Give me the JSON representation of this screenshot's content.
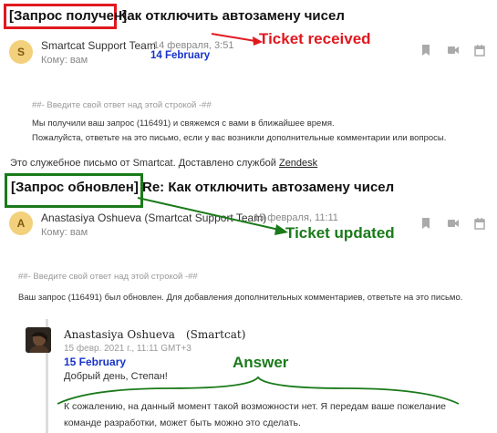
{
  "ticket1": {
    "status_tag": "[Запрос получен]",
    "subject": "Как отключить автозамену чисел",
    "avatar_letter": "S",
    "sender": "Smartcat Support Team",
    "date": "14 февраля, 3:51",
    "to": "Кому: вам",
    "date_note": "14 February",
    "annotation": "Ticket received",
    "reply_marker": "##- Введите свой ответ над этой строкой -##",
    "body_lines": [
      "Мы получили ваш запрос (116491) и свяжемся с вами в ближайшее время.",
      "Пожалуйста, ответьте на это письмо, если у вас возникли дополнительные комментарии или вопросы."
    ],
    "footer_prefix": "Это служебное письмо от Smartcat. Доставлено службой ",
    "footer_link": "Zendesk"
  },
  "ticket2": {
    "status_tag": "[Запрос обновлен]",
    "subject": "Re: Как отключить автозамену чисел",
    "avatar_letter": "A",
    "sender": "Anastasiya Oshueva (Smartcat Support Team)",
    "date": "15 февраля, 11:11",
    "to": "Кому: вам",
    "annotation": "Ticket updated",
    "reply_marker": "##- Введите свой ответ над этой строкой -##",
    "body_line": "Ваш запрос (116491) был обновлен. Для добавления дополнительных комментариев, ответьте на это письмо."
  },
  "reply": {
    "author": "Anastasiya Oshueva",
    "org": "(Smartcat)",
    "timestamp": "15 февр. 2021 г., 11:11 GMT+3",
    "date_note": "15 February",
    "greeting": "Добрый день, Степан!",
    "annotation": "Answer",
    "text_lines": [
      "К сожалению, на данный момент такой возможности нет. Я передам ваше пожелание",
      "команде разработки, может быть можно это сделать."
    ]
  },
  "icons": [
    "bookmark-icon",
    "video-icon",
    "calendar-icon"
  ],
  "colors": {
    "red": "#e0191f",
    "green": "#1a7a1a",
    "blue": "#1733c9",
    "avatar": "#f3d07b"
  }
}
